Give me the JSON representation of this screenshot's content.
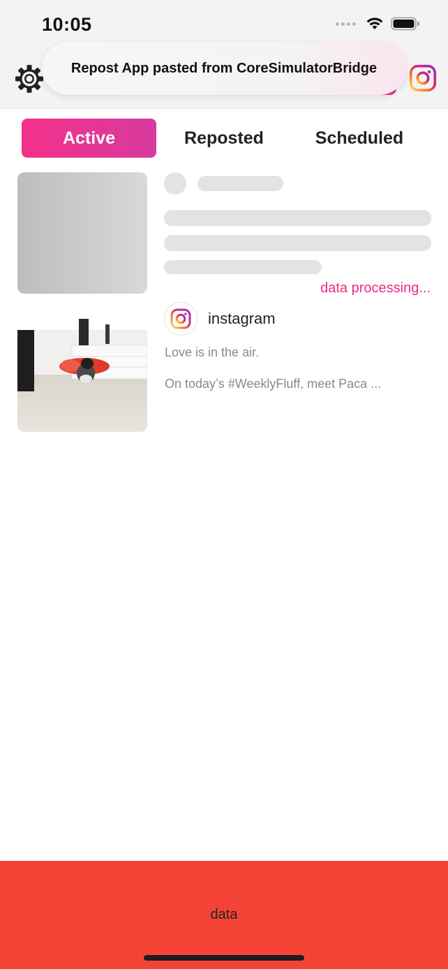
{
  "status_bar": {
    "time": "10:05"
  },
  "toast": {
    "message": "Repost App pasted from CoreSimulatorBridge"
  },
  "header": {
    "settings_icon": "gear-icon",
    "instagram_icon": "instagram-icon"
  },
  "tabs": [
    {
      "label": "Active",
      "selected": true
    },
    {
      "label": "Reposted",
      "selected": false
    },
    {
      "label": "Scheduled",
      "selected": false
    }
  ],
  "posts": [
    {
      "state": "loading",
      "status_text": "data processing..."
    },
    {
      "username": "instagram",
      "caption_line1": "Love is in the air.",
      "caption_line2": "On today’s #WeeklyFluff, meet Paca ..."
    }
  ],
  "bottom_bar": {
    "label": "data"
  },
  "colors": {
    "accent": "#ee2a86",
    "bottom_bar": "#f44336",
    "tab_gradient_start": "#f3318a",
    "tab_gradient_end": "#d73a9f"
  }
}
